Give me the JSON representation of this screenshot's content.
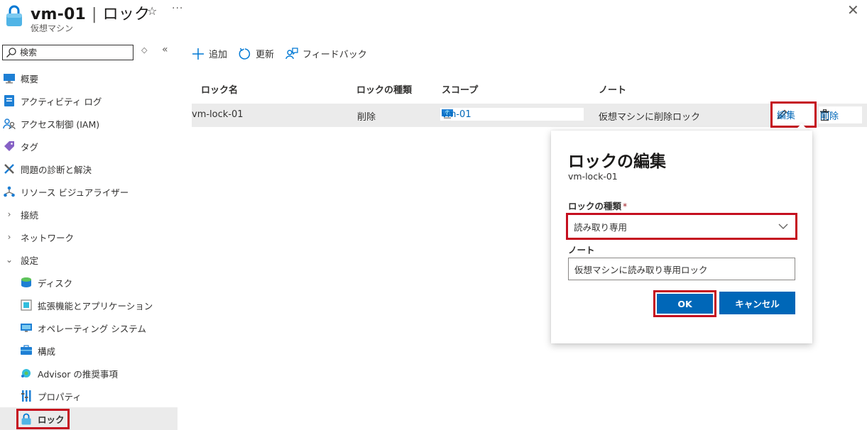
{
  "header": {
    "title": "vm-01",
    "separator": "|",
    "page": "ロック",
    "subtitle": "仮想マシン",
    "favorite": "☆",
    "more": "···",
    "close": "✕"
  },
  "search": {
    "placeholder": "検索",
    "collapse": "◇",
    "collapse_all": "«"
  },
  "sidebar": {
    "items": [
      {
        "label": "概要",
        "icon": "overview-icon"
      },
      {
        "label": "アクティビティ ログ",
        "icon": "activity-log-icon"
      },
      {
        "label": "アクセス制御 (IAM)",
        "icon": "iam-icon"
      },
      {
        "label": "タグ",
        "icon": "tag-icon"
      },
      {
        "label": "問題の診断と解決",
        "icon": "diagnose-icon"
      },
      {
        "label": "リソース ビジュアライザー",
        "icon": "visualizer-icon"
      },
      {
        "label": "接続",
        "icon": "chevron-right-icon"
      },
      {
        "label": "ネットワーク",
        "icon": "chevron-right-icon"
      },
      {
        "label": "設定",
        "icon": "chevron-down-icon"
      },
      {
        "label": "ディスク",
        "icon": "disk-icon"
      },
      {
        "label": "拡張機能とアプリケーション",
        "icon": "extensions-icon"
      },
      {
        "label": "オペレーティング システム",
        "icon": "os-icon"
      },
      {
        "label": "構成",
        "icon": "configuration-icon"
      },
      {
        "label": "Advisor の推奨事項",
        "icon": "advisor-icon"
      },
      {
        "label": "プロパティ",
        "icon": "properties-icon"
      },
      {
        "label": "ロック",
        "icon": "lock-icon"
      }
    ]
  },
  "toolbar": {
    "add": "追加",
    "refresh": "更新",
    "feedback": "フィードバック"
  },
  "table": {
    "columns": [
      "ロック名",
      "ロックの種類",
      "スコープ",
      "ノート"
    ],
    "rows": [
      {
        "name": "vm-lock-01",
        "type": "削除",
        "scope": "vm-01",
        "note": "仮想マシンに削除ロック",
        "edit": "編集",
        "delete": "削除"
      }
    ]
  },
  "popup": {
    "title": "ロックの編集",
    "subtitle": "vm-lock-01",
    "type_label": "ロックの種類",
    "required_mark": "*",
    "type_value": "読み取り専用",
    "note_label": "ノート",
    "note_value": "仮想マシンに読み取り専用ロック",
    "ok": "OK",
    "cancel": "キャンセル"
  },
  "colors": {
    "accent": "#0067b8",
    "highlight_border": "#c50f1f",
    "selected_row": "#ebebeb"
  }
}
